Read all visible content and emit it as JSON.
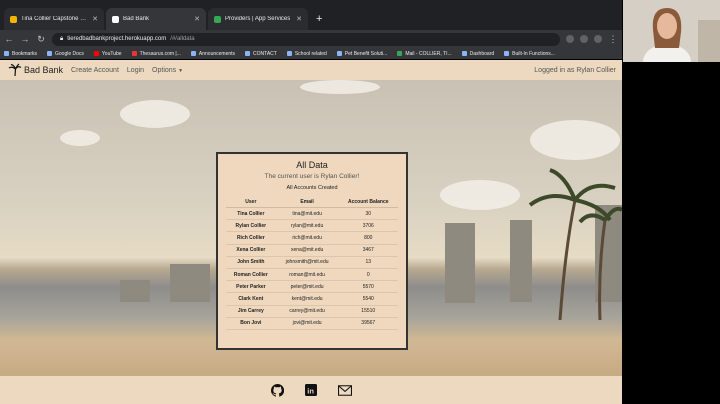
{
  "tabs": [
    {
      "label": "Tina Collier Capstone - Google",
      "color": "#f4b400",
      "active": false
    },
    {
      "label": "Bad Bank",
      "color": "#ffffff",
      "active": true
    },
    {
      "label": "Providers | App Services",
      "color": "#34a853",
      "active": false
    }
  ],
  "address": {
    "host": "tieredbadbankproject.herokuapp.com",
    "path": "/#/alldata"
  },
  "bookmarks": [
    "Bookmarks",
    "Google Docs",
    "YouTube",
    "Thesaurus.com |...",
    "Announcements",
    "CONTACT",
    "School related",
    "Pet Benefit Soluti...",
    "Mail - COLLIER, TI...",
    "Dashboard",
    "Built-In Functions..."
  ],
  "navbar": {
    "brand": "Bad Bank",
    "links": [
      "Create Account",
      "Login",
      "Options"
    ],
    "logged_in": "Logged in as Rylan Collier"
  },
  "card": {
    "title": "All Data",
    "current_user": "The current user is Rylan Collier!",
    "subtitle": "All Accounts Created",
    "headers": [
      "User",
      "Email",
      "Account Balance"
    ],
    "rows": [
      [
        "Tina Collier",
        "tina@mit.edu",
        "30"
      ],
      [
        "Rylan Collier",
        "rylan@mit.edu",
        "3706"
      ],
      [
        "Rich Collier",
        "rich@mit.edu",
        "800"
      ],
      [
        "Xena Collier",
        "xena@mit.edu",
        "3467"
      ],
      [
        "John Smith",
        "johnsmith@mit.edu",
        "13"
      ],
      [
        "Roman Collier",
        "roman@mit.edu",
        "0"
      ],
      [
        "Peter Parker",
        "peter@mit.edu",
        "5570"
      ],
      [
        "Clark Kent",
        "kent@mit.edu",
        "5540"
      ],
      [
        "Jim Carrey",
        "carrey@mit.edu",
        "15510"
      ],
      [
        "Bon Jovi",
        "jovi@mit.edu",
        "39567"
      ]
    ]
  },
  "footer_icons": [
    "github-icon",
    "linkedin-icon",
    "mail-icon"
  ]
}
